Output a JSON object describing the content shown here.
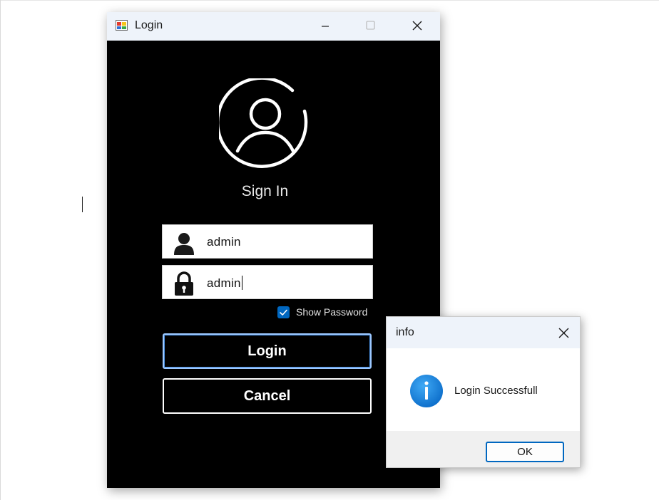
{
  "login_window": {
    "title": "Login",
    "heading": "Sign In",
    "username": {
      "value": "admin",
      "icon": "user-icon"
    },
    "password": {
      "value": "admin",
      "icon": "lock-icon"
    },
    "show_password": {
      "label": "Show Password",
      "checked": true
    },
    "login_button": "Login",
    "cancel_button": "Cancel",
    "avatar_icon": "user-circle-icon"
  },
  "info_dialog": {
    "title": "info",
    "message": "Login Successfull",
    "ok_button": "OK",
    "icon": "info-icon"
  },
  "colors": {
    "window_background": "#000000",
    "titlebar_background": "#eef3fa",
    "accent": "#0067c0",
    "info_icon_blue": "#1a86d9"
  }
}
